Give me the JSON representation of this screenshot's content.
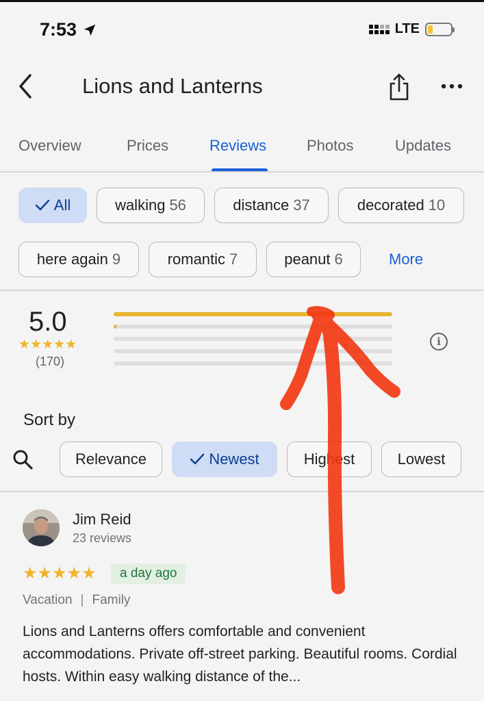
{
  "status_bar": {
    "time": "7:53",
    "network": "LTE"
  },
  "header": {
    "title": "Lions and Lanterns"
  },
  "tabs": [
    {
      "label": "Overview"
    },
    {
      "label": "Prices"
    },
    {
      "label": "Reviews",
      "active": true
    },
    {
      "label": "Photos"
    },
    {
      "label": "Updates"
    }
  ],
  "filter_chips": [
    {
      "label": "All",
      "selected": true
    },
    {
      "label": "walking",
      "count": "56"
    },
    {
      "label": "distance",
      "count": "37"
    },
    {
      "label": "decorated",
      "count": "10"
    },
    {
      "label": "here again",
      "count": "9"
    },
    {
      "label": "romantic",
      "count": "7"
    },
    {
      "label": "peanut",
      "count": "6"
    }
  ],
  "more_label": "More",
  "rating": {
    "value": "5.0",
    "stars": "★★★★★",
    "count": "(170)",
    "distribution": [
      {
        "stars": 5,
        "fraction": 1.0
      },
      {
        "stars": 4,
        "fraction": 0.01
      },
      {
        "stars": 3,
        "fraction": 0
      },
      {
        "stars": 2,
        "fraction": 0
      },
      {
        "stars": 1,
        "fraction": 0
      }
    ]
  },
  "sort": {
    "label": "Sort by",
    "options": [
      {
        "label": "Relevance"
      },
      {
        "label": "Newest",
        "selected": true
      },
      {
        "label": "Highest"
      },
      {
        "label": "Lowest"
      }
    ]
  },
  "review": {
    "name": "Jim Reid",
    "meta": "23 reviews",
    "stars": "★★★★★",
    "date": "a day ago",
    "tags": [
      "Vacation",
      "Family"
    ],
    "tag_separator": "|",
    "text": "Lions and Lanterns offers comfortable and convenient accommodations. Private off-street parking. Beautiful rooms. Cordial hosts. Within easy walking distance of the..."
  },
  "colors": {
    "accent": "#1a5fd8",
    "star": "#f0b429",
    "selected_chip": "#cfdcf5",
    "annotation_arrow": "#f2360f"
  },
  "icons": [
    "location-arrow-icon",
    "back-arrow-icon",
    "share-icon",
    "more-dots-icon",
    "checkmark-icon",
    "info-icon",
    "search-icon"
  ]
}
